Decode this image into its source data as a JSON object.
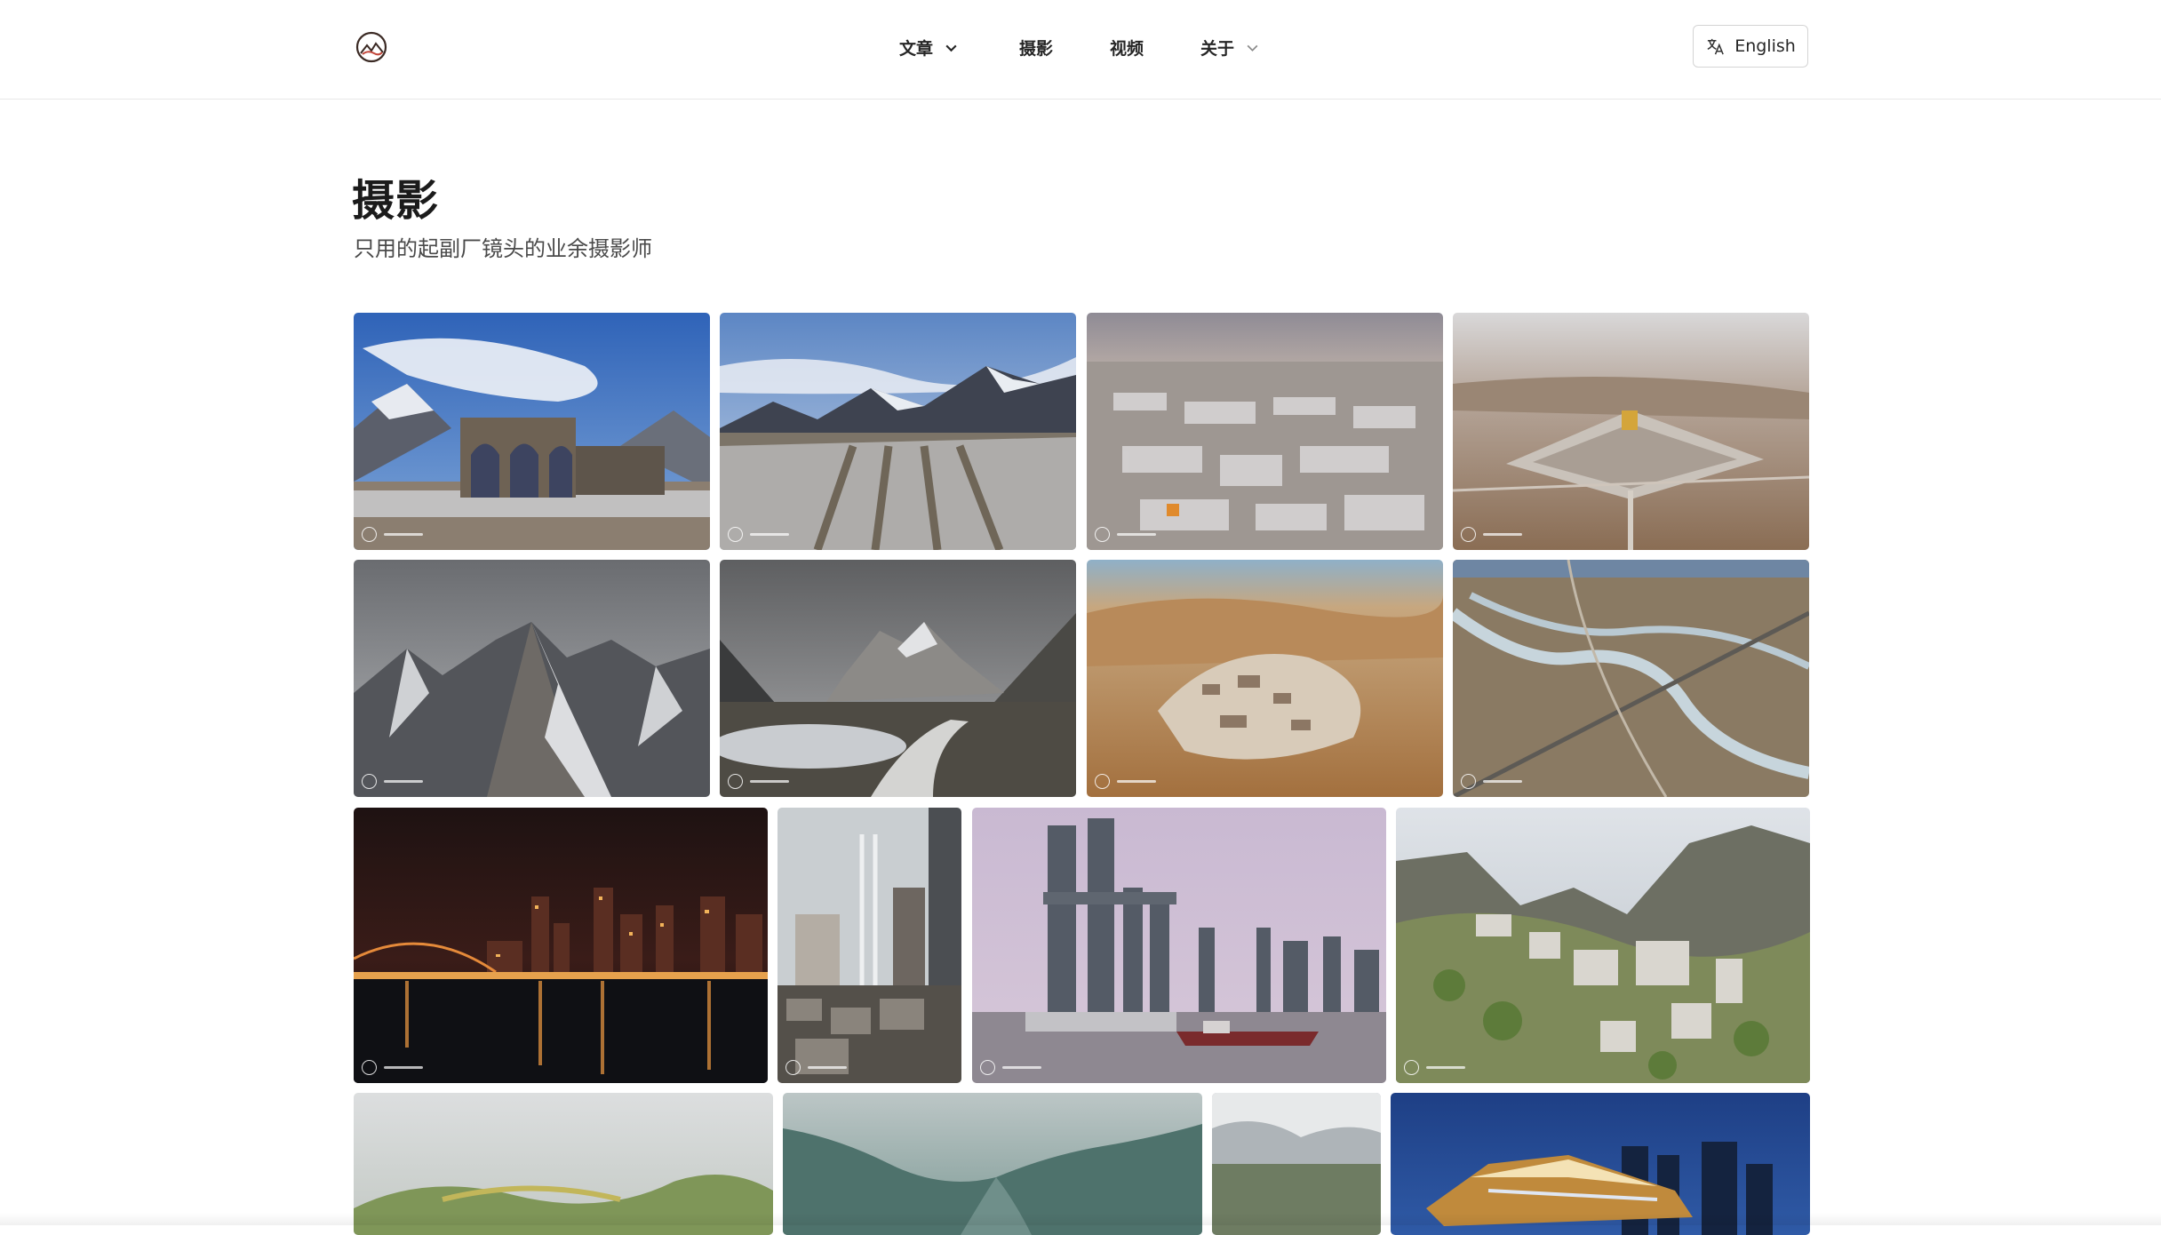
{
  "nav": {
    "items": [
      {
        "label": "文章",
        "has_chevron": true
      },
      {
        "label": "摄影",
        "has_chevron": false
      },
      {
        "label": "视频",
        "has_chevron": false
      },
      {
        "label": "关于",
        "has_chevron": true
      }
    ],
    "language_button": "English"
  },
  "page": {
    "title": "摄影",
    "subtitle": "只用的起副厂镜头的业余摄影师"
  },
  "gallery": {
    "photos": [
      {
        "subject": "ruined stone arches under blue sky with snowy mountains"
      },
      {
        "subject": "snowy mountain range above rows of ruined walls"
      },
      {
        "subject": "aerial view of snowy town"
      },
      {
        "subject": "aerial view of monastery on brown plateau"
      },
      {
        "subject": "jagged snowy mountain peak"
      },
      {
        "subject": "winding road past lake in mountain valley"
      },
      {
        "subject": "aerial view of desert village"
      },
      {
        "subject": "aerial view of braided river and highway"
      },
      {
        "subject": "city skyline at night with reflections"
      },
      {
        "subject": "misty high-rises and bridge above old town"
      },
      {
        "subject": "skyscrapers by river with cargo ship"
      },
      {
        "subject": "aerial view of mountain town"
      },
      {
        "subject": "misty green hills"
      },
      {
        "subject": "mountain gorge in haze"
      },
      {
        "subject": "cloudy landscape"
      },
      {
        "subject": "modern building illuminated at dusk"
      }
    ]
  }
}
